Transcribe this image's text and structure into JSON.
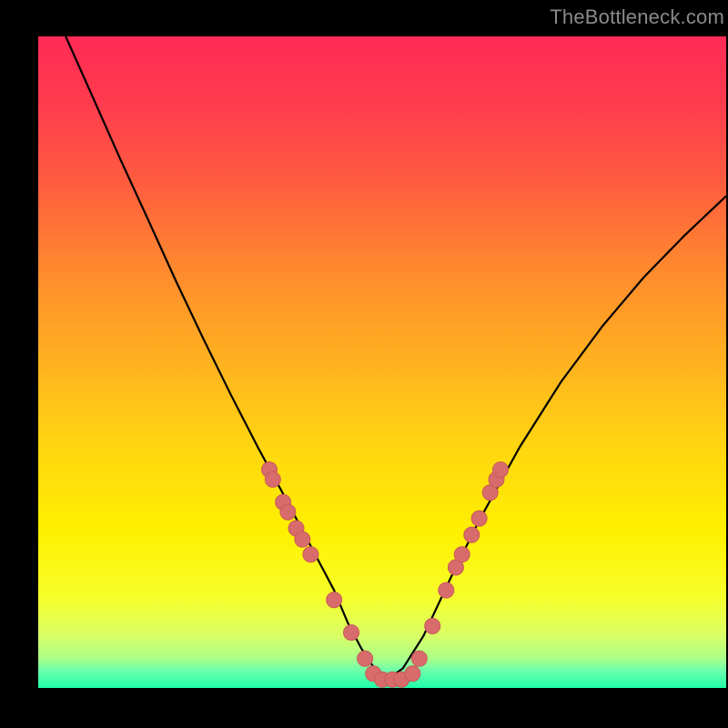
{
  "watermark": {
    "text": "TheBottleneck.com"
  },
  "colors": {
    "frame": "#000000",
    "curve_stroke": "#000000",
    "marker_fill": "#d86b6b",
    "marker_stroke": "#c95a5a"
  },
  "gradient_stops": [
    {
      "offset": 0.0,
      "color": "#ff2a55"
    },
    {
      "offset": 0.1,
      "color": "#ff3b4e"
    },
    {
      "offset": 0.22,
      "color": "#ff5b3f"
    },
    {
      "offset": 0.36,
      "color": "#ff8a2e"
    },
    {
      "offset": 0.5,
      "color": "#ffb21f"
    },
    {
      "offset": 0.64,
      "color": "#ffd80f"
    },
    {
      "offset": 0.76,
      "color": "#fff000"
    },
    {
      "offset": 0.86,
      "color": "#f6ff2a"
    },
    {
      "offset": 0.92,
      "color": "#d9ff66"
    },
    {
      "offset": 0.955,
      "color": "#aaff8a"
    },
    {
      "offset": 0.975,
      "color": "#66ffad"
    },
    {
      "offset": 1.0,
      "color": "#1fffa8"
    }
  ],
  "chart_data": {
    "type": "line",
    "title": "",
    "xlabel": "",
    "ylabel": "",
    "xlim": [
      0,
      1
    ],
    "ylim": [
      0,
      1
    ],
    "grid": false,
    "legend": false,
    "series": [
      {
        "name": "bottleneck-curve",
        "x": [
          0.04,
          0.08,
          0.12,
          0.16,
          0.2,
          0.24,
          0.28,
          0.32,
          0.36,
          0.4,
          0.43,
          0.45,
          0.47,
          0.49,
          0.51,
          0.53,
          0.56,
          0.6,
          0.64,
          0.7,
          0.76,
          0.82,
          0.88,
          0.94,
          1.0
        ],
        "y": [
          1.0,
          0.905,
          0.81,
          0.718,
          0.625,
          0.536,
          0.45,
          0.368,
          0.29,
          0.21,
          0.15,
          0.1,
          0.06,
          0.028,
          0.015,
          0.03,
          0.08,
          0.17,
          0.255,
          0.37,
          0.47,
          0.555,
          0.63,
          0.695,
          0.755
        ]
      }
    ],
    "markers": [
      {
        "x": 0.336,
        "y": 0.335
      },
      {
        "x": 0.341,
        "y": 0.32
      },
      {
        "x": 0.356,
        "y": 0.285
      },
      {
        "x": 0.363,
        "y": 0.27
      },
      {
        "x": 0.375,
        "y": 0.245
      },
      {
        "x": 0.384,
        "y": 0.228
      },
      {
        "x": 0.396,
        "y": 0.205
      },
      {
        "x": 0.43,
        "y": 0.135
      },
      {
        "x": 0.455,
        "y": 0.085
      },
      {
        "x": 0.475,
        "y": 0.045
      },
      {
        "x": 0.487,
        "y": 0.022
      },
      {
        "x": 0.5,
        "y": 0.013
      },
      {
        "x": 0.515,
        "y": 0.013
      },
      {
        "x": 0.528,
        "y": 0.013
      },
      {
        "x": 0.544,
        "y": 0.022
      },
      {
        "x": 0.554,
        "y": 0.045
      },
      {
        "x": 0.573,
        "y": 0.095
      },
      {
        "x": 0.593,
        "y": 0.15
      },
      {
        "x": 0.607,
        "y": 0.185
      },
      {
        "x": 0.616,
        "y": 0.205
      },
      {
        "x": 0.63,
        "y": 0.235
      },
      {
        "x": 0.641,
        "y": 0.26
      },
      {
        "x": 0.657,
        "y": 0.3
      },
      {
        "x": 0.666,
        "y": 0.32
      },
      {
        "x": 0.672,
        "y": 0.335
      }
    ]
  }
}
